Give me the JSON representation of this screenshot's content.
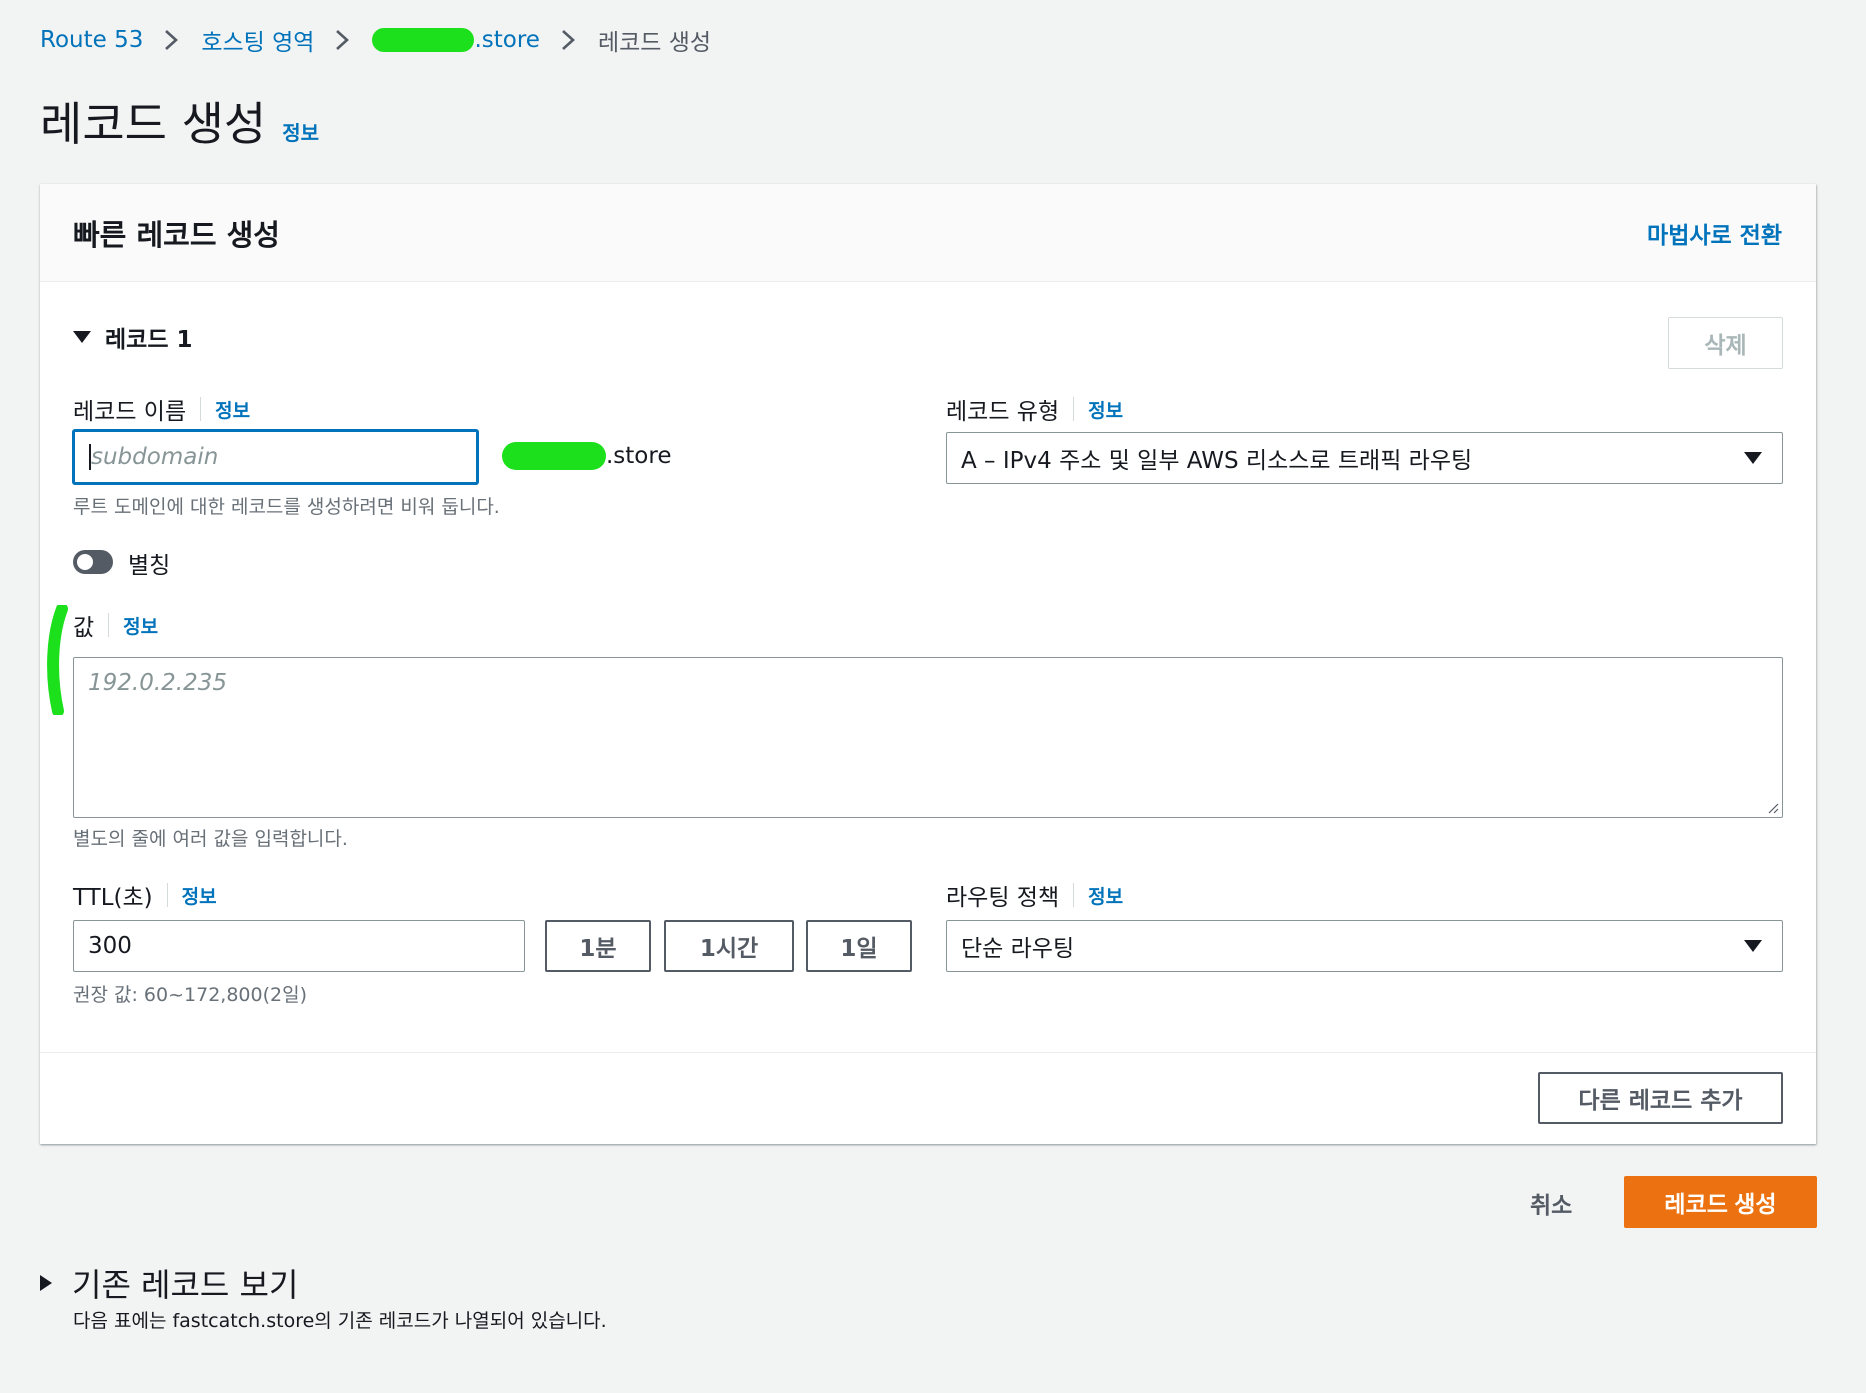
{
  "breadcrumb": {
    "items": [
      "Route 53",
      "호스팅 영역"
    ],
    "domain_suffix": ".store",
    "current": "레코드 생성"
  },
  "page": {
    "title": "레코드 생성",
    "info": "정보"
  },
  "panel": {
    "title": "빠른 레코드 생성",
    "wizard_link": "마법사로 전환",
    "record_heading": "레코드 1",
    "delete_label": "삭제",
    "record_name": {
      "label": "레코드 이름",
      "info": "정보",
      "placeholder": "subdomain",
      "suffix": ".store",
      "hint": "루트 도메인에 대한 레코드를 생성하려면 비워 둡니다."
    },
    "record_type": {
      "label": "레코드 유형",
      "info": "정보",
      "value": "A – IPv4 주소 및 일부 AWS 리소스로 트래픽 라우팅"
    },
    "alias": {
      "label": "별칭",
      "on": false
    },
    "value": {
      "label": "값",
      "info": "정보",
      "placeholder": "192.0.2.235",
      "hint": "별도의 줄에 여러 값을 입력합니다."
    },
    "ttl": {
      "label": "TTL(초)",
      "info": "정보",
      "value": "300",
      "presets": [
        "1분",
        "1시간",
        "1일"
      ],
      "hint": "권장 값: 60~172,800(2일)"
    },
    "routing": {
      "label": "라우팅 정책",
      "info": "정보",
      "value": "단순 라우팅"
    },
    "add_record_label": "다른 레코드 추가"
  },
  "actions": {
    "cancel": "취소",
    "create": "레코드 생성"
  },
  "existing": {
    "title": "기존 레코드 보기",
    "description": "다음 표에는 fastcatch.store의 기존 레코드가 나열되어 있습니다."
  },
  "colors": {
    "link": "#0073bb",
    "primary": "#ec7211",
    "background": "#f2f3f3",
    "redaction": "#1de01d"
  }
}
